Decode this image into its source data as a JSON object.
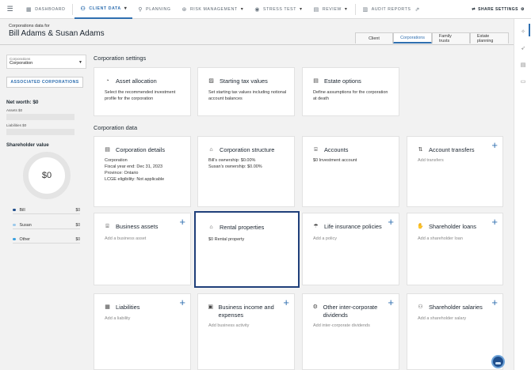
{
  "nav": {
    "items": [
      {
        "label": "DASHBOARD",
        "icon": "dashboard-icon"
      },
      {
        "label": "CLIENT DATA",
        "icon": "client-data-icon",
        "active": true
      },
      {
        "label": "PLANNING",
        "icon": "planning-icon"
      },
      {
        "label": "RISK MANAGEMENT",
        "icon": "risk-icon"
      },
      {
        "label": "STRESS TEST",
        "icon": "stress-test-icon"
      },
      {
        "label": "REVIEW",
        "icon": "review-icon"
      },
      {
        "label": "AUDIT REPORTS",
        "icon": "audit-reports-icon"
      }
    ],
    "share": "SHARE SETTINGS"
  },
  "header": {
    "subtitle": "Corporations data for",
    "title": "Bill Adams & Susan Adams",
    "tabs": [
      "Client",
      "Corporations",
      "Family trusts",
      "Estate planning"
    ],
    "active_tab": "Corporations"
  },
  "left": {
    "select_label": "Corporations",
    "select_value": "Corporation",
    "assoc_button": "ASSOCIATED CORPORATIONS",
    "net_worth": "Net worth: $0",
    "assets": "Assets $0",
    "liabilities": "Liabilities $0",
    "shareholder_title": "Shareholder value",
    "donut_value": "$0",
    "legend": [
      {
        "name": "Bill",
        "amount": "$0",
        "color": "#1f4e8c"
      },
      {
        "name": "Susan",
        "amount": "$0",
        "color": "#9cc9ea"
      },
      {
        "name": "Other",
        "amount": "$0",
        "color": "#3aa0e0"
      }
    ]
  },
  "settings": {
    "title": "Corporation settings",
    "cards": [
      {
        "title": "Asset allocation",
        "desc": "Select the recommended investment profile for the corporation"
      },
      {
        "title": "Starting tax values",
        "desc": "Set starting tax values including notional account balances"
      },
      {
        "title": "Estate options",
        "desc": "Define assumptions for the corporation at death"
      }
    ]
  },
  "data": {
    "title": "Corporation data",
    "cards": [
      {
        "title": "Corporation details",
        "desc": [
          "Corporation",
          "Fiscal year end: Dec 31, 2023",
          "Province: Ontario",
          "LCGE eligibility: Not applicable"
        ]
      },
      {
        "title": "Corporation structure",
        "desc": [
          "Bill's ownership: $0.00%",
          "Susan's ownership: $0.00%"
        ]
      },
      {
        "title": "Accounts",
        "desc": [
          "$0 Investment account"
        ]
      },
      {
        "title": "Account transfers",
        "desc": [
          "Add transfers"
        ]
      },
      {
        "title": "Business assets",
        "desc": [
          "Add a business asset"
        ]
      },
      {
        "title": "Rental properties",
        "desc": [
          "$0 Rental property"
        ]
      },
      {
        "title": "Life insurance policies",
        "desc": [
          "Add a policy"
        ]
      },
      {
        "title": "Shareholder loans",
        "desc": [
          "Add a shareholder loan"
        ]
      },
      {
        "title": "Liabilities",
        "desc": [
          "Add a liability"
        ]
      },
      {
        "title": "Business income and expenses",
        "desc": [
          "Add business activity"
        ]
      },
      {
        "title": "Other inter-corporate dividends",
        "desc": [
          "Add inter-corporate dividends"
        ]
      },
      {
        "title": "Shareholder salaries",
        "desc": [
          "Add a shareholder salary"
        ]
      }
    ]
  },
  "plus": "+"
}
